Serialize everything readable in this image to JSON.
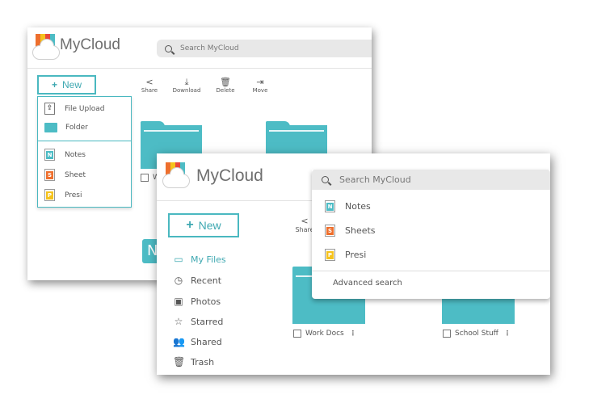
{
  "app_name": "MyCloud",
  "search_placeholder": "Search MyCloud",
  "new_button": "New",
  "colors": {
    "accent": "#4ab8c0",
    "folder": "#4dbcc5",
    "notes": "#4dbcc5",
    "sheet": "#ee6f2d",
    "presi": "#f5c21c"
  },
  "back": {
    "toolbar": {
      "share": "Share",
      "download": "Download",
      "delete": "Delete",
      "move": "Move"
    },
    "new_menu": [
      {
        "label": "File Upload",
        "icon": "upload-icon"
      },
      {
        "label": "Folder",
        "icon": "folder-icon"
      },
      {
        "label": "Notes",
        "icon": "notes-file-icon",
        "letter": "N"
      },
      {
        "label": "Sheet",
        "icon": "sheet-file-icon",
        "letter": "S"
      },
      {
        "label": "Presi",
        "icon": "presi-file-icon",
        "letter": "P"
      }
    ],
    "partial_folder_label": "W",
    "partial_tile_letter": "N"
  },
  "front": {
    "share": "Share",
    "sidebar": [
      {
        "label": "My Files",
        "icon": "folder-outline-icon",
        "active": true
      },
      {
        "label": "Recent",
        "icon": "clock-icon"
      },
      {
        "label": "Photos",
        "icon": "photos-icon"
      },
      {
        "label": "Starred",
        "icon": "star-icon"
      },
      {
        "label": "Shared",
        "icon": "people-icon"
      },
      {
        "label": "Trash",
        "icon": "trash-icon"
      }
    ],
    "folders": [
      {
        "label": "Work Docs"
      },
      {
        "label": "School Stuff"
      }
    ],
    "search_dropdown": {
      "items": [
        {
          "label": "Notes",
          "letter": "N",
          "icon": "notes-file-icon"
        },
        {
          "label": "Sheets",
          "letter": "S",
          "icon": "sheets-file-icon"
        },
        {
          "label": "Presi",
          "letter": "P",
          "icon": "presi-file-icon"
        }
      ],
      "advanced": "Advanced search"
    }
  }
}
